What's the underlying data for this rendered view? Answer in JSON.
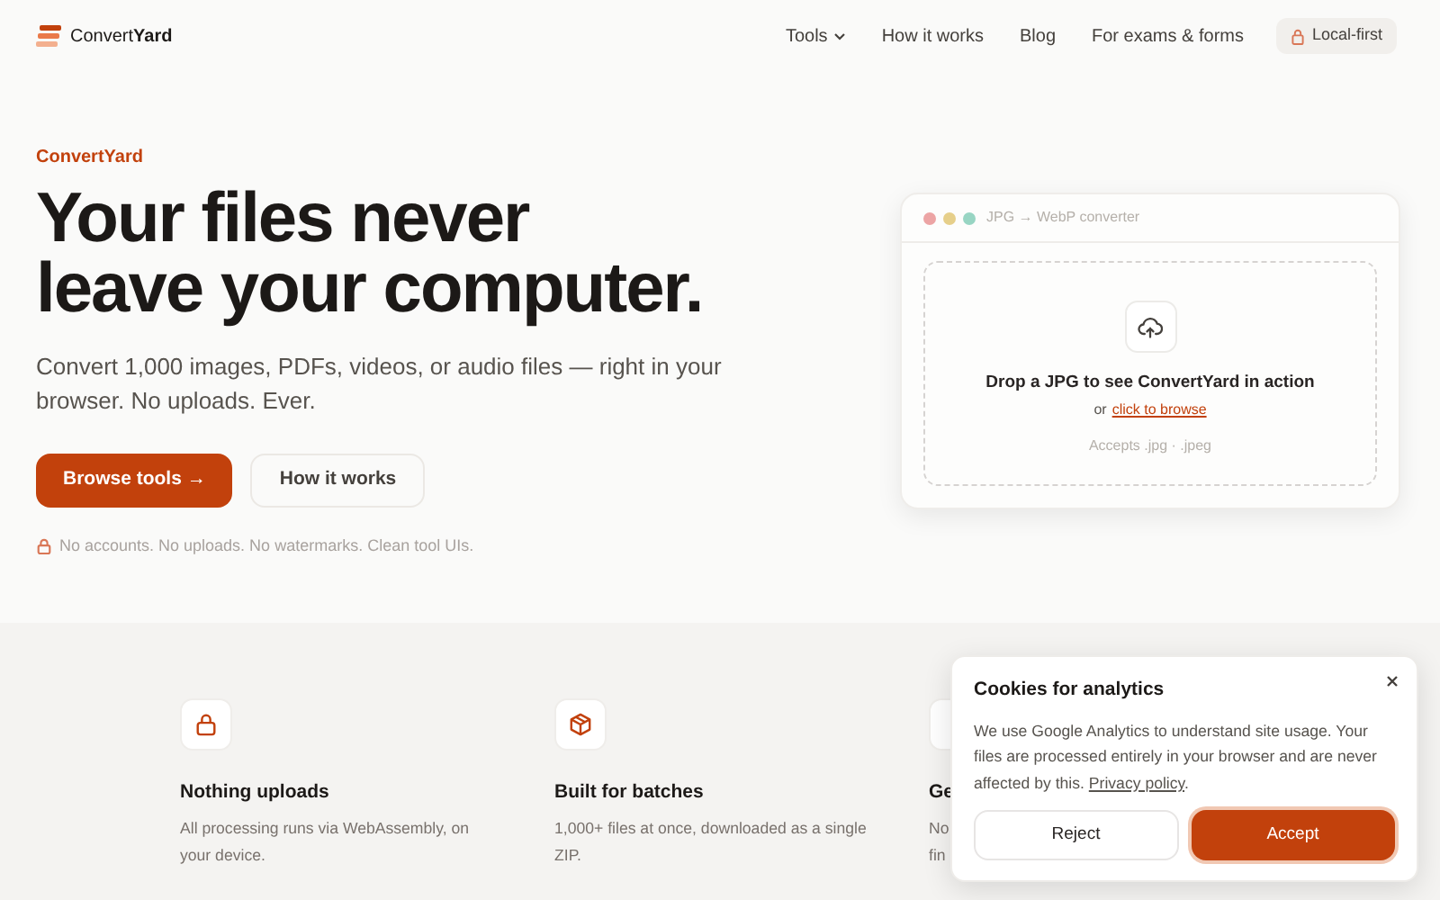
{
  "header": {
    "logo": "Convert",
    "logo_bold": "Yard",
    "nav": [
      {
        "label": "Tools",
        "dropdown": true
      },
      {
        "label": "How it works",
        "dropdown": false
      },
      {
        "label": "Blog",
        "dropdown": false
      },
      {
        "label": "For exams & forms",
        "dropdown": false
      }
    ],
    "badge": "Local-first"
  },
  "hero": {
    "eyebrow": "ConvertYard",
    "title_lines": [
      "Your files never",
      "leave your computer."
    ],
    "subtitle": "Convert 1,000 images, PDFs, videos, or audio files — right in your browser. No uploads. Ever.",
    "primary_button": "Browse tools →",
    "secondary_button": "How it works",
    "note": "No accounts. No uploads. No watermarks. Clean tool UIs."
  },
  "demo": {
    "title": "JPG → WebP converter",
    "drop_text": "Drop a JPG to see ConvertYard in action",
    "or": "or",
    "browse_link": "click to browse",
    "accepts": "Accepts .jpg · .jpeg"
  },
  "features": [
    {
      "kind": "lock",
      "title": "Nothing uploads",
      "description_lines": [
        "All processing runs via WebAssembly, on",
        "your device."
      ]
    },
    {
      "kind": "box",
      "title": "Built for batches",
      "description_lines": [
        "1,000+ files at once, downloaded as a single",
        "ZIP."
      ]
    },
    {
      "kind": "other",
      "title": "Ge",
      "description_lines": [
        "No",
        "fin"
      ]
    }
  ],
  "cookie_banner": {
    "title": "Cookies for analytics",
    "text": "We use Google Analytics to understand site usage. Your files are processed entirely in your browser and are never affected by this.",
    "link": "Privacy policy",
    "after_link": ".",
    "reject": "Reject",
    "accept": "Accept"
  }
}
